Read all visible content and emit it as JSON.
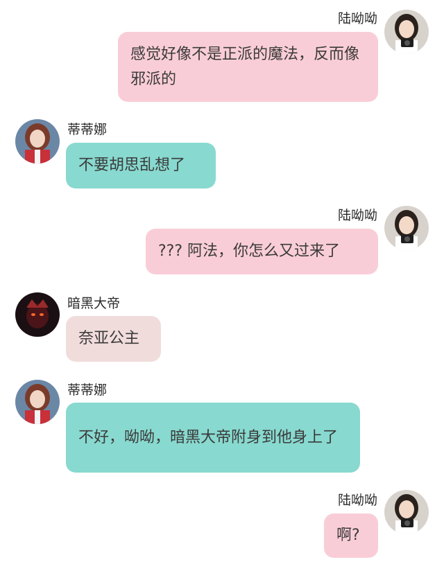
{
  "messages": [
    {
      "side": "right",
      "sender": "陆呦呦",
      "avatar": "girl-with-camera-avatar",
      "text": "感觉好像不是正派的魔法，反而像邪派的"
    },
    {
      "side": "left",
      "sender": "蒂蒂娜",
      "avatar": "girl-red-outfit-avatar",
      "text": "不要胡思乱想了"
    },
    {
      "side": "right",
      "sender": "陆呦呦",
      "avatar": "girl-with-camera-avatar",
      "text": "??? 阿法，你怎么又过来了"
    },
    {
      "side": "left",
      "sender": "暗黑大帝",
      "avatar": "dark-emperor-avatar",
      "text": "奈亚公主"
    },
    {
      "side": "left",
      "sender": "蒂蒂娜",
      "avatar": "girl-red-outfit-avatar",
      "text": "不好，呦呦，暗黑大帝附身到他身上了"
    },
    {
      "side": "right",
      "sender": "陆呦呦",
      "avatar": "girl-with-camera-avatar",
      "text": "啊?"
    }
  ],
  "colors": {
    "pink_bubble": "#f9cdd7",
    "teal_bubble": "#88d9cf",
    "rose_bubble": "#f1dcdc",
    "background": "#ffffff"
  }
}
